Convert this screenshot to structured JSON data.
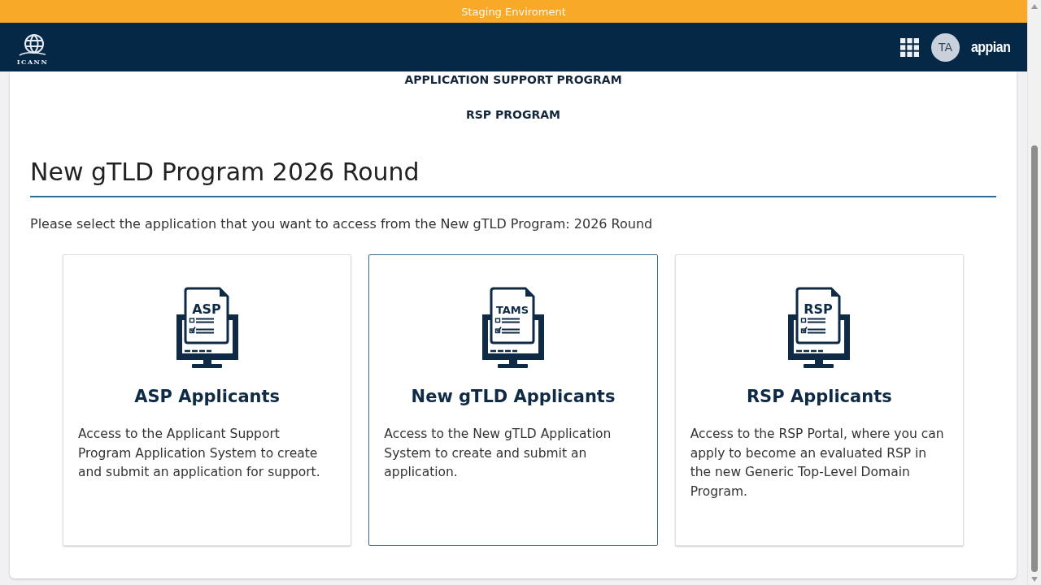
{
  "banner": {
    "text": "Staging Enviroment"
  },
  "header": {
    "logo_text": "ICANN",
    "avatar": "TA",
    "brand": "appian"
  },
  "program_links": [
    "APPLICATION SUPPORT PROGRAM",
    "RSP PROGRAM"
  ],
  "page": {
    "title": "New gTLD Program 2026 Round",
    "intro": "Please select the application that you want to access from the New gTLD Program: 2026 Round"
  },
  "cards": [
    {
      "icon_label": "ASP",
      "title": "ASP Applicants",
      "description": "Access to the Applicant Support\nProgram Application System to create\nand submit an application for support.",
      "selected": false
    },
    {
      "icon_label": "TAMS",
      "title": "New gTLD Applicants",
      "description": "Access to the New gTLD Application\nSystem to create and submit an\napplication.",
      "selected": true
    },
    {
      "icon_label": "RSP",
      "title": "RSP Applicants",
      "description": "Access to the RSP Portal, where you can\napply to become an evaluated RSP in\nthe new Generic Top-Level Domain\nProgram.",
      "selected": false
    }
  ]
}
